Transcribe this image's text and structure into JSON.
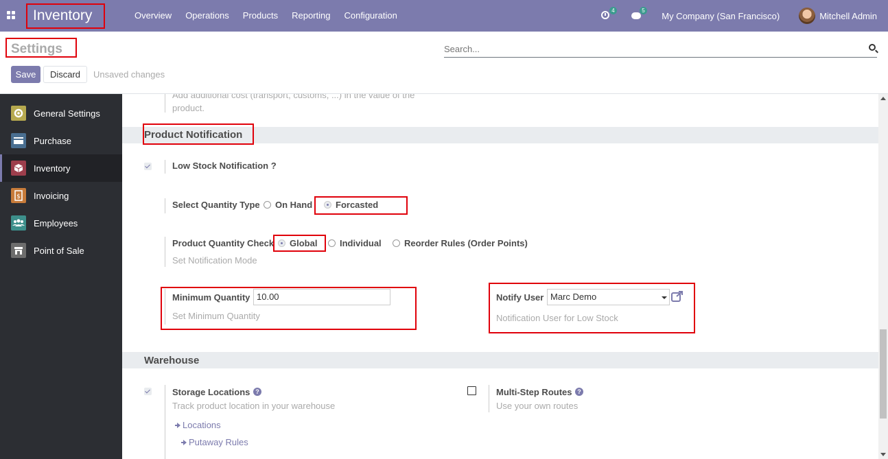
{
  "navbar": {
    "app_name": "Inventory",
    "menu": [
      "Overview",
      "Operations",
      "Products",
      "Reporting",
      "Configuration"
    ],
    "activity_count": "4",
    "messages_count": "5",
    "company": "My Company (San Francisco)",
    "user": "Mitchell Admin"
  },
  "control_panel": {
    "title": "Settings",
    "search_placeholder": "Search...",
    "save_label": "Save",
    "discard_label": "Discard",
    "unsaved_label": "Unsaved changes"
  },
  "sidebar": {
    "items": [
      {
        "label": "General Settings",
        "icon": "gear-icon",
        "color": "#b6a94f"
      },
      {
        "label": "Purchase",
        "icon": "credit-card-icon",
        "color": "#4a6f91"
      },
      {
        "label": "Inventory",
        "icon": "box-icon",
        "color": "#9d3e4c"
      },
      {
        "label": "Invoicing",
        "icon": "invoice-icon",
        "color": "#c77b3a"
      },
      {
        "label": "Employees",
        "icon": "users-icon",
        "color": "#3d8f8b"
      },
      {
        "label": "Point of Sale",
        "icon": "store-icon",
        "color": "#6d6d6d"
      }
    ],
    "active": "Inventory"
  },
  "main": {
    "landed_cost_help_line1": "Add additional cost (transport, customs, ...) in the value of the",
    "landed_cost_help_line2": "product.",
    "product_notification": {
      "section_title": "Product Notification",
      "low_stock_label": "Low Stock Notification ?",
      "low_stock_checked": true,
      "quantity_type_label": "Select Quantity Type",
      "quantity_type_options": [
        "On Hand",
        "Forcasted"
      ],
      "quantity_type_selected": "Forcasted",
      "quantity_check_label": "Product Quantity Check",
      "quantity_check_options": [
        "Global",
        "Individual",
        "Reorder Rules (Order Points)"
      ],
      "quantity_check_selected": "Global",
      "quantity_check_help": "Set Notification Mode",
      "min_qty_label": "Minimum Quantity",
      "min_qty_value": "10.00",
      "min_qty_help": "Set Minimum Quantity",
      "notify_user_label": "Notify User",
      "notify_user_value": "Marc Demo",
      "notify_user_help": "Notification User for Low Stock"
    },
    "warehouse": {
      "section_title": "Warehouse",
      "storage_label": "Storage Locations",
      "storage_checked": true,
      "storage_help": "Track product location in your warehouse",
      "locations_link": "Locations",
      "putaway_link": "Putaway Rules",
      "multistep_label": "Multi-Step Routes",
      "multistep_checked": false,
      "multistep_help": "Use your own routes"
    }
  },
  "colors": {
    "navbar": "#7c7bad",
    "accent": "#7c7bad",
    "highlight_box": "#e0000a",
    "sidebar_bg": "#2c2e33"
  }
}
